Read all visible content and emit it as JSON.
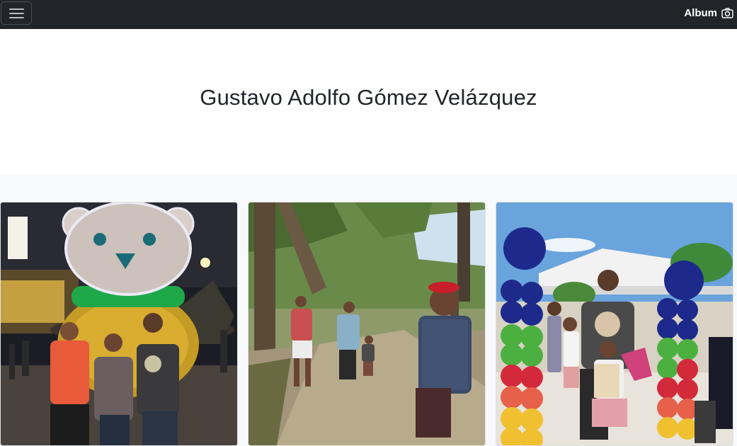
{
  "navbar": {
    "toggler_icon": "hamburger-menu-icon",
    "brand_label": "Album",
    "brand_icon": "camera-icon"
  },
  "hero": {
    "title": "Gustavo Adolfo Gómez Velázquez"
  },
  "photos": [
    {
      "name": "photo-christmas-bear"
    },
    {
      "name": "photo-forest-walk"
    },
    {
      "name": "photo-balloon-celebration"
    }
  ],
  "colors": {
    "navbar_bg": "#212529",
    "hero_bg": "#ffffff",
    "album_bg": "#f8f9fa"
  }
}
